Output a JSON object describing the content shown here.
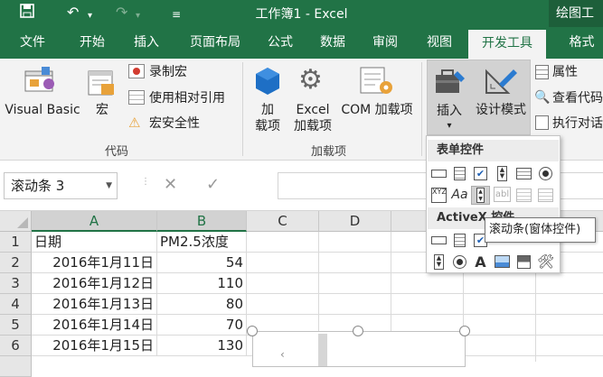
{
  "title_bar": {
    "title": "工作簿1 - Excel",
    "contextual_title": "绘图工具"
  },
  "tabs": [
    "文件",
    "开始",
    "插入",
    "页面布局",
    "公式",
    "数据",
    "审阅",
    "视图",
    "开发工具",
    "格式"
  ],
  "active_tab": "开发工具",
  "ribbon": {
    "code": {
      "visual_basic": "Visual Basic",
      "macros": "宏",
      "record_macro": "录制宏",
      "relative_ref": "使用相对引用",
      "macro_security": "宏安全性",
      "group": "代码"
    },
    "addins": {
      "addins_line1": "加",
      "addins_line2": "载项",
      "excel_addins_line1": "Excel",
      "excel_addins_line2": "加载项",
      "com_addins": "COM 加载项",
      "group": "加载项"
    },
    "controls": {
      "insert": "插入",
      "design_mode": "设计模式",
      "properties": "属性",
      "view_code": "查看代码",
      "run_dialog": "执行对话"
    }
  },
  "name_box": "滚动条 3",
  "columns": [
    "A",
    "B",
    "C",
    "D"
  ],
  "rows": [
    {
      "n": "1",
      "a": "日期",
      "b": "PM2.5浓度"
    },
    {
      "n": "2",
      "a": "2016年1月11日",
      "b": "54"
    },
    {
      "n": "3",
      "a": "2016年1月12日",
      "b": "110"
    },
    {
      "n": "4",
      "a": "2016年1月13日",
      "b": "80"
    },
    {
      "n": "5",
      "a": "2016年1月14日",
      "b": "70"
    },
    {
      "n": "6",
      "a": "2016年1月15日",
      "b": "130"
    }
  ],
  "dropdown": {
    "form_header": "表单控件",
    "activex_header": "ActiveX 控件"
  },
  "tooltip": "滚动条(窗体控件)"
}
